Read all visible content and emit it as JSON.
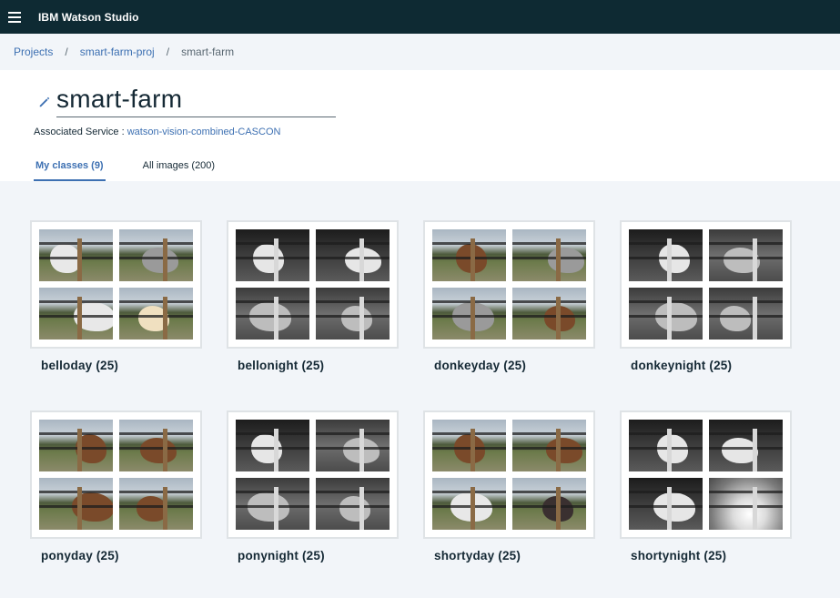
{
  "app": {
    "title": "IBM Watson Studio"
  },
  "breadcrumb": [
    {
      "label": "Projects"
    },
    {
      "label": "smart-farm-proj"
    },
    {
      "label": "smart-farm"
    }
  ],
  "breadcrumb_separator": "/",
  "header": {
    "title": "smart-farm",
    "associated_label": "Associated Service :",
    "associated_value": "watson-vision-combined-CASCON"
  },
  "tabs": [
    {
      "label": "My classes (9)",
      "active": true
    },
    {
      "label": "All images (200)",
      "active": false
    }
  ],
  "classes": [
    {
      "label": "belloday (25)",
      "thumbs": [
        "day-white",
        "day-grey",
        "day-white",
        "sunset-white"
      ]
    },
    {
      "label": "bellonight (25)",
      "thumbs": [
        "night-white",
        "night-white",
        "night-grey",
        "night-grey"
      ]
    },
    {
      "label": "donkeyday (25)",
      "thumbs": [
        "day-brown",
        "day-grey",
        "day-grey",
        "day-brown"
      ]
    },
    {
      "label": "donkeynight (25)",
      "thumbs": [
        "night-white",
        "night-grey",
        "night-grey",
        "night-grey"
      ]
    },
    {
      "label": "ponyday (25)",
      "thumbs": [
        "day-brown",
        "day-brown",
        "day-brown",
        "day-brown"
      ]
    },
    {
      "label": "ponynight (25)",
      "thumbs": [
        "night-white",
        "night-grey",
        "night-grey",
        "night-grey"
      ]
    },
    {
      "label": "shortyday (25)",
      "thumbs": [
        "day-brown",
        "day-brown",
        "day-white",
        "day-dark"
      ]
    },
    {
      "label": "shortynight (25)",
      "thumbs": [
        "night-white",
        "night-white",
        "night-white",
        "bright"
      ]
    }
  ],
  "colors": {
    "topbar": "#0e2a33",
    "link": "#3d70b2",
    "page_bg": "#f2f5f9",
    "card_border": "#dfe3e6"
  },
  "icons": {
    "menu": "hamburger-icon",
    "edit": "pencil-icon"
  }
}
